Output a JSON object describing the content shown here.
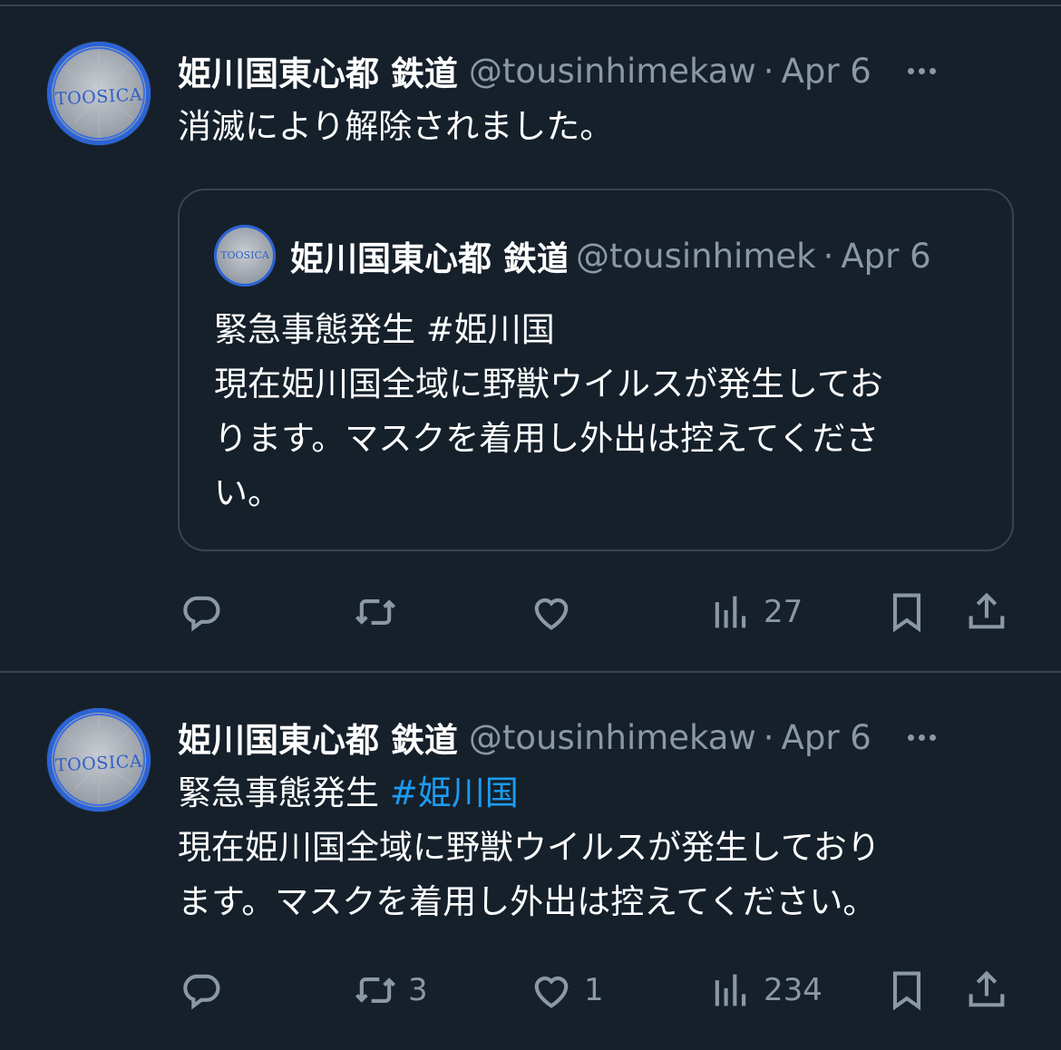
{
  "tweets": [
    {
      "author": {
        "name": "姫川国東心都 鉄道",
        "handle": "@tousinhimekaw",
        "avatar_text": "TOOSICA"
      },
      "separator": "·",
      "date": "Apr 6",
      "text_lines": [
        "消滅により解除されました。"
      ],
      "quote": {
        "author": {
          "name": "姫川国東心都 鉄道",
          "handle": "@tousinhimek",
          "avatar_text": "TOOSICA"
        },
        "separator": "·",
        "date": "Apr 6",
        "text_lines": [
          "緊急事態発生 #姫川国",
          "現在姫川国全域に野獣ウイルスが発生してお",
          "ります。マスクを着用し外出は控えてくださ",
          "い。"
        ]
      },
      "stats": {
        "replies": "",
        "retweets": "",
        "likes": "",
        "views": "27"
      }
    },
    {
      "author": {
        "name": "姫川国東心都 鉄道",
        "handle": "@tousinhimekaw",
        "avatar_text": "TOOSICA"
      },
      "separator": "·",
      "date": "Apr 6",
      "text_first": "緊急事態発生 ",
      "hashtag": "#姫川国",
      "text_lines": [
        "現在姫川国全域に野獣ウイルスが発生しており",
        "ます。マスクを着用し外出は控えてください。"
      ],
      "stats": {
        "replies": "",
        "retweets": "3",
        "likes": "1",
        "views": "234"
      }
    }
  ],
  "colors": {
    "background": "#15202b",
    "text": "#ffffff",
    "secondary": "#8b98a5",
    "border": "#38444d",
    "link": "#1d9bf0"
  },
  "icons": [
    "reply-icon",
    "retweet-icon",
    "like-icon",
    "views-icon",
    "bookmark-icon",
    "share-icon",
    "more-icon"
  ]
}
